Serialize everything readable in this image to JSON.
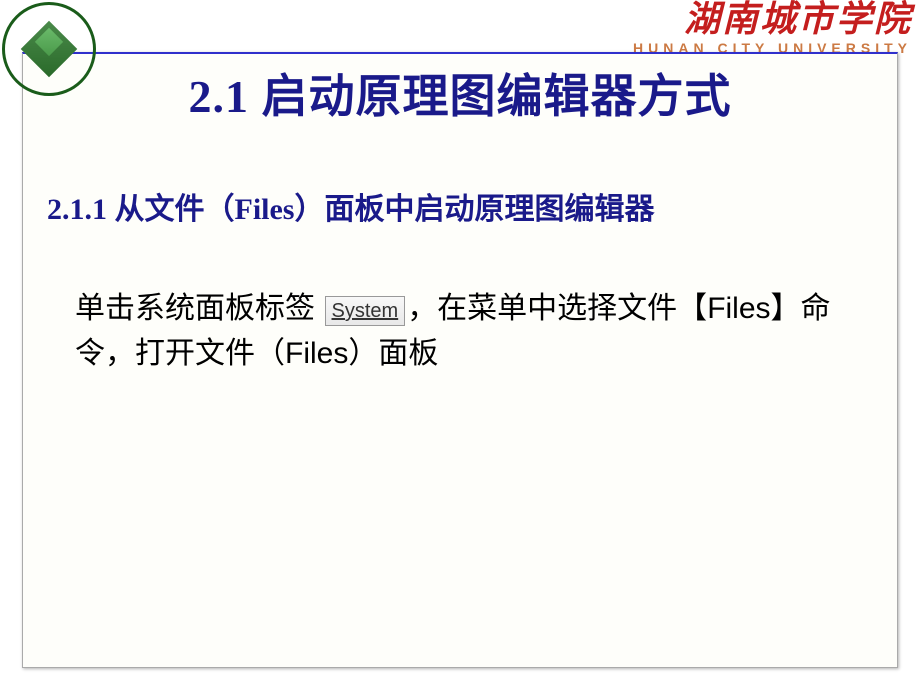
{
  "header": {
    "university_cn": "湖南城市学院",
    "university_en": "HUNAN CITY UNIVERSITY"
  },
  "slide": {
    "title": "2.1  启动原理图编辑器方式",
    "section": "2.1.1  从文件（Files）面板中启动原理图编辑器",
    "body_part1": "单击系统面板标签 ",
    "system_button": "System",
    "body_part2": "，在菜单中选择文件【",
    "body_files1": "Files",
    "body_part3": "】命令，打开文件（",
    "body_files2": "Files",
    "body_part4": "）面板"
  }
}
